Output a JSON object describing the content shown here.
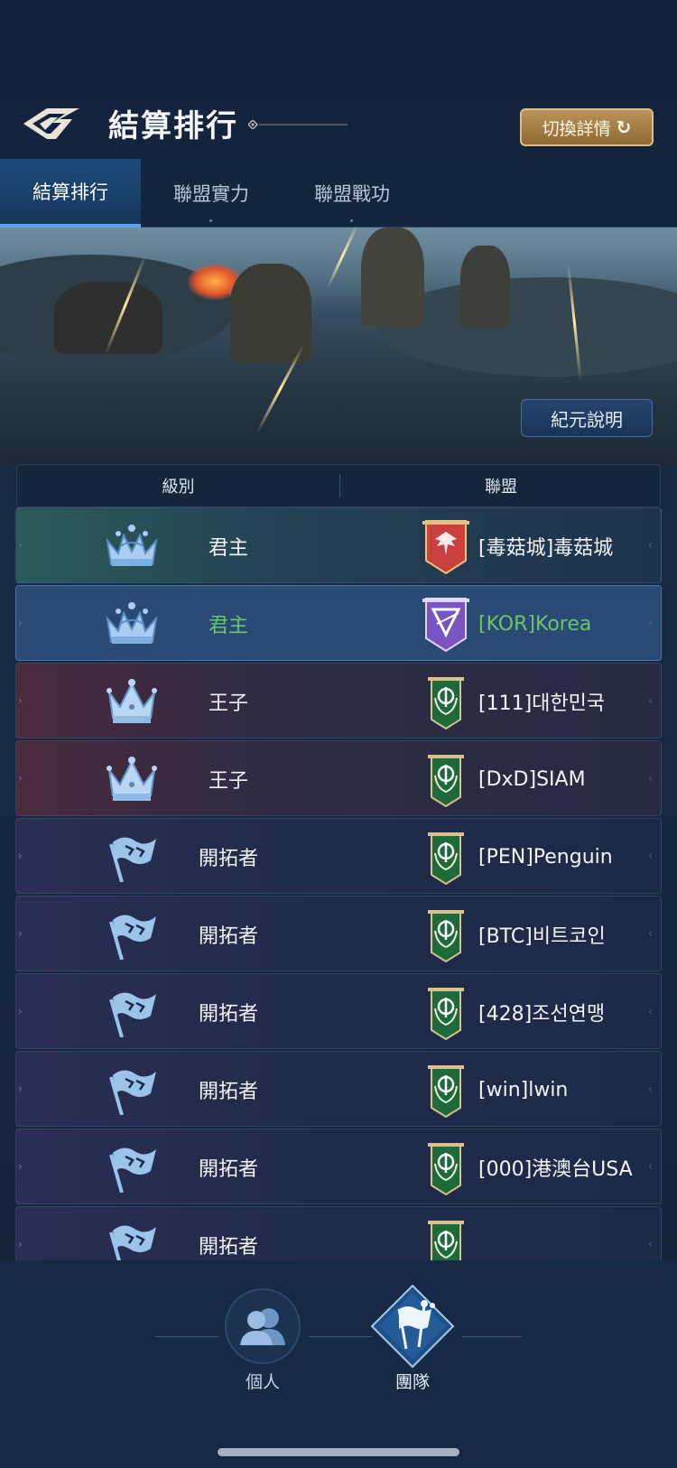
{
  "header": {
    "title": "結算排行",
    "switch_button": "切換詳情",
    "refresh_icon": "↻"
  },
  "tabs": [
    {
      "label": "結算排行",
      "active": true
    },
    {
      "label": "聯盟實力",
      "active": false
    },
    {
      "label": "聯盟戰功",
      "active": false
    }
  ],
  "banner": {
    "era_button": "紀元說明"
  },
  "table": {
    "col_rank": "級別",
    "col_alliance": "聯盟"
  },
  "rows": [
    {
      "rank": "君主",
      "rank_icon": "crown-icon",
      "alliance": "[毒菇城]毒菇城",
      "emblem": "red-eagle-banner-icon",
      "tier": "green",
      "highlight": false
    },
    {
      "rank": "君主",
      "rank_icon": "crown-icon",
      "alliance": "[KOR]Korea",
      "emblem": "purple-banner-icon",
      "tier": "blue",
      "highlight": true
    },
    {
      "rank": "王子",
      "rank_icon": "prince-crown-icon",
      "alliance": "[111]대한민국",
      "emblem": "green-laurel-banner-icon",
      "tier": "red",
      "highlight": false
    },
    {
      "rank": "王子",
      "rank_icon": "prince-crown-icon",
      "alliance": "[DxD]SIAM",
      "emblem": "green-laurel-banner-icon",
      "tier": "red",
      "highlight": false
    },
    {
      "rank": "開拓者",
      "rank_icon": "flag-icon",
      "alliance": "[PEN]Penguin",
      "emblem": "green-laurel-banner-icon",
      "tier": "navy",
      "highlight": false
    },
    {
      "rank": "開拓者",
      "rank_icon": "flag-icon",
      "alliance": "[BTC]비트코인",
      "emblem": "green-laurel-banner-icon",
      "tier": "navy",
      "highlight": false
    },
    {
      "rank": "開拓者",
      "rank_icon": "flag-icon",
      "alliance": "[428]조선연맹",
      "emblem": "green-laurel-banner-icon",
      "tier": "navy",
      "highlight": false
    },
    {
      "rank": "開拓者",
      "rank_icon": "flag-icon",
      "alliance": "[win]lwin",
      "emblem": "green-laurel-banner-icon",
      "tier": "navy",
      "highlight": false
    },
    {
      "rank": "開拓者",
      "rank_icon": "flag-icon",
      "alliance": "[000]港澳台USA",
      "emblem": "green-laurel-banner-icon",
      "tier": "navy",
      "highlight": false
    },
    {
      "rank": "開拓者",
      "rank_icon": "flag-icon",
      "alliance": "",
      "emblem": "green-laurel-banner-icon",
      "tier": "navy",
      "highlight": false
    }
  ],
  "bottom_nav": [
    {
      "label": "個人",
      "icon": "people-icon",
      "active": false
    },
    {
      "label": "團隊",
      "icon": "team-flag-icon",
      "active": true
    }
  ],
  "colors": {
    "highlight_text": "#6fc36a",
    "active_tab": "#1d4a7c",
    "gold_button": "#b9935a"
  }
}
